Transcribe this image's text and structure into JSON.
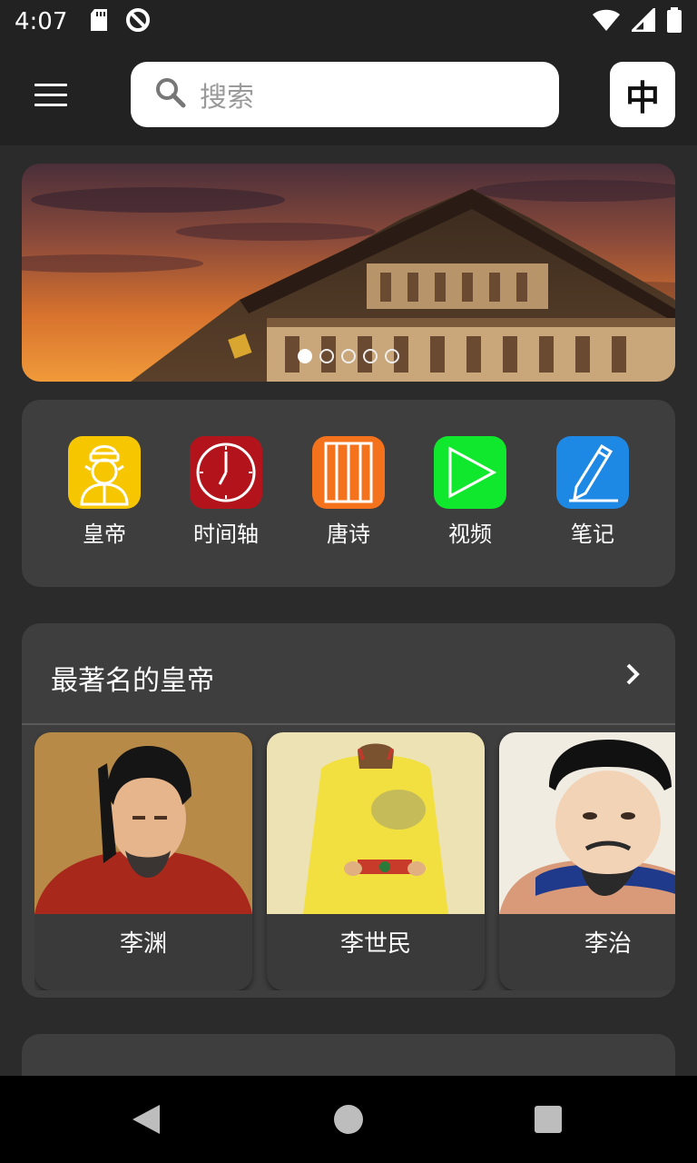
{
  "status_bar": {
    "time": "4:07",
    "left_icons": [
      "sd-card-icon",
      "no-disturb-icon"
    ],
    "right_icons": [
      "wifi-icon",
      "signal-icon",
      "battery-icon"
    ]
  },
  "app_bar": {
    "menu_icon": "hamburger-menu-icon",
    "search": {
      "placeholder": "搜索",
      "icon": "search-icon"
    },
    "language_button_label": "中"
  },
  "banner": {
    "image": "tang-palace-sunset",
    "slide_count": 5,
    "active_slide": 1
  },
  "categories": [
    {
      "label": "皇帝",
      "icon": "emperor-icon",
      "color": "#f6c700"
    },
    {
      "label": "时间轴",
      "icon": "clock-icon",
      "color": "#b3141c"
    },
    {
      "label": "唐诗",
      "icon": "poetry-scroll-icon",
      "color": "#f5721d"
    },
    {
      "label": "视频",
      "icon": "play-icon",
      "color": "#10e82e"
    },
    {
      "label": "笔记",
      "icon": "pencil-icon",
      "color": "#1e88e5"
    }
  ],
  "famous_emperors": {
    "title": "最著名的皇帝",
    "more_icon": "chevron-right-icon",
    "items": [
      {
        "name": "李渊",
        "portrait": "li-yuan-portrait"
      },
      {
        "name": "李世民",
        "portrait": "li-shimin-portrait"
      },
      {
        "name": "李治",
        "portrait": "li-zhi-portrait"
      }
    ]
  },
  "nav_bar": {
    "icons": [
      "back-icon",
      "home-icon",
      "recent-apps-icon"
    ]
  }
}
